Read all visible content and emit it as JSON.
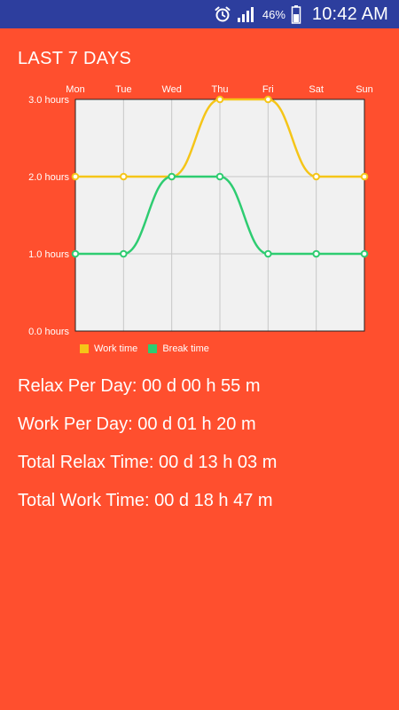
{
  "status_bar": {
    "battery_percent": "46%",
    "time": "10:42 AM",
    "icons": [
      "alarm-clock-icon",
      "signal-icon",
      "battery-icon"
    ]
  },
  "page": {
    "title": "LAST 7 DAYS"
  },
  "chart_data": {
    "type": "line",
    "title": "",
    "xlabel": "",
    "ylabel": "",
    "categories": [
      "Mon",
      "Tue",
      "Wed",
      "Thu",
      "Fri",
      "Sat",
      "Sun"
    ],
    "y_ticks": [
      0,
      1,
      2,
      3
    ],
    "y_tick_labels": [
      "0.0 hours",
      "1.0 hours",
      "2.0 hours",
      "3.0 hours"
    ],
    "ylim": [
      0,
      3.0
    ],
    "grid": true,
    "legend_position": "bottom-left",
    "plot_background": "#F1F1F1",
    "series": [
      {
        "name": "Work time",
        "color": "#F5C518",
        "values": [
          2.0,
          2.0,
          2.0,
          3.0,
          3.0,
          2.0,
          2.0
        ]
      },
      {
        "name": "Break time",
        "color": "#2ECC71",
        "values": [
          1.0,
          1.0,
          2.0,
          2.0,
          1.0,
          1.0,
          1.0
        ]
      }
    ]
  },
  "stats": [
    "Relax Per Day: 00 d 00 h 55 m",
    "Work Per Day: 00 d 01 h 20 m",
    "Total Relax Time: 00 d 13 h 03 m",
    "Total Work Time: 00 d 18 h 47 m"
  ],
  "colors": {
    "background": "#FF4F2E",
    "status_bar": "#2D3E9E"
  }
}
